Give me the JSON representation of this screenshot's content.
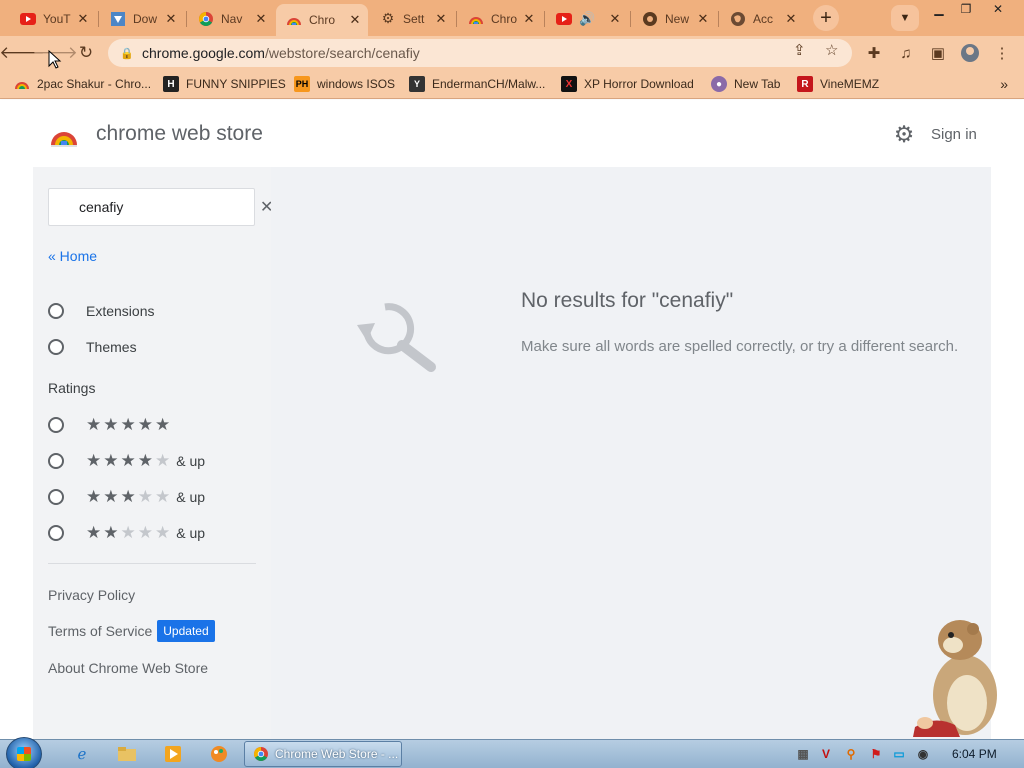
{
  "browser": {
    "tabs": [
      {
        "title": "YouT",
        "icon": "youtube-icon"
      },
      {
        "title": "Dow",
        "icon": "download-icon"
      },
      {
        "title": "Nav",
        "icon": "chrome-icon"
      },
      {
        "title": "Chro",
        "icon": "webstore-icon",
        "active": true
      },
      {
        "title": "Sett",
        "icon": "gear-icon"
      },
      {
        "title": "Chro",
        "icon": "webstore-icon"
      },
      {
        "title": "",
        "icon": "youtube-icon",
        "playing": true
      },
      {
        "title": "New",
        "icon": "chrome-icon"
      },
      {
        "title": "Acc",
        "icon": "globe-icon"
      }
    ],
    "tab_close_glyph": "✕",
    "new_tab_glyph": "+",
    "url_host": "chrome.google.com",
    "url_path": "/webstore/search/cenafiy",
    "bookmarks": [
      {
        "label": "2pac Shakur - Chro...",
        "icon": "webstore-icon"
      },
      {
        "label": "FUNNY SNIPPIES",
        "icon": "h-icon"
      },
      {
        "label": "windows ISOS",
        "icon": "ph-icon"
      },
      {
        "label": "EndermanCH/Malw...",
        "icon": "github-icon"
      },
      {
        "label": "XP Horror Download",
        "icon": "x-icon"
      },
      {
        "label": "New Tab",
        "icon": "app-icon"
      },
      {
        "label": "VineMEMZ",
        "icon": "r-icon"
      }
    ],
    "bookmarks_more": "»"
  },
  "store": {
    "title": "chrome web store",
    "sign_in": "Sign in",
    "search": {
      "value": "cenafiy",
      "clear": "✕"
    },
    "home_link": "« Home",
    "categories": [
      "Extensions",
      "Themes"
    ],
    "ratings_heading": "Ratings",
    "ratings": [
      {
        "stars": 5,
        "suffix": ""
      },
      {
        "stars": 4,
        "suffix": "& up"
      },
      {
        "stars": 3,
        "suffix": "& up"
      },
      {
        "stars": 2,
        "suffix": "& up"
      }
    ],
    "footer_links": {
      "privacy": "Privacy Policy",
      "terms": "Terms of Service",
      "terms_badge": "Updated",
      "about": "About Chrome Web Store"
    },
    "no_results_title": "No results for \"cenafiy\"",
    "no_results_message": "Make sure all words are spelled correctly, or try a different search."
  },
  "taskbar": {
    "active_task": "Chrome Web Store - ...",
    "clock": "6:04 PM"
  },
  "colors": {
    "tab_strip": "#f0b07e",
    "toolbar": "#f7cba7",
    "link_blue": "#1a73e8"
  }
}
